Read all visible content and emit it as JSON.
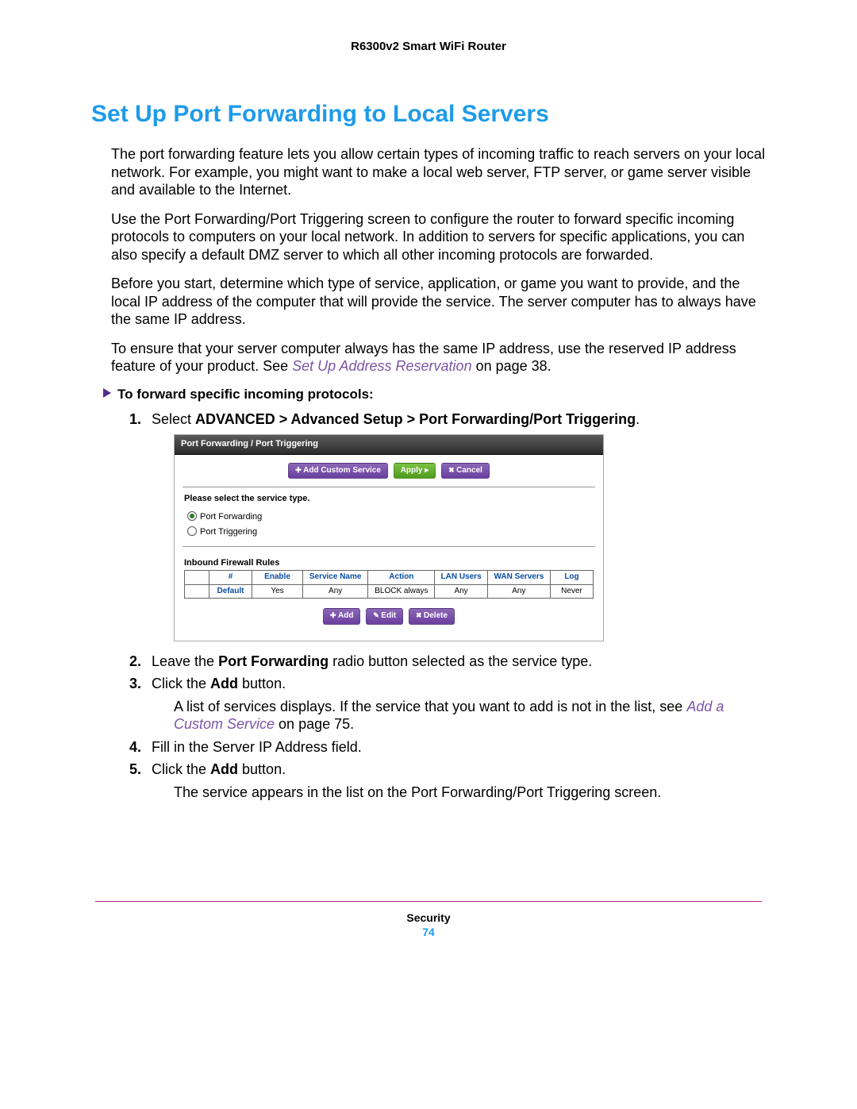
{
  "header": {
    "product": "R6300v2 Smart WiFi Router"
  },
  "title": "Set Up Port Forwarding to Local Servers",
  "paragraphs": {
    "p1": "The port forwarding feature lets you allow certain types of incoming traffic to reach servers on your local network. For example, you might want to make a local web server, FTP server, or game server visible and available to the Internet.",
    "p2": "Use the Port Forwarding/Port Triggering screen to configure the router to forward specific incoming protocols to computers on your local network. In addition to servers for specific applications, you can also specify a default DMZ server to which all other incoming protocols are forwarded.",
    "p3": "Before you start, determine which type of service, application, or game you want to provide, and the local IP address of the computer that will provide the service. The server computer has to always have the same IP address.",
    "p4a": "To ensure that your server computer always has the same IP address, use the reserved IP address feature of your product. See ",
    "p4link": "Set Up Address Reservation",
    "p4b": " on page 38."
  },
  "subheading": "To forward specific incoming protocols:",
  "steps": {
    "s1num": "1.",
    "s1a": "Select ",
    "s1b": "ADVANCED > Advanced Setup > Port Forwarding/Port Triggering",
    "s1c": ".",
    "s2num": "2.",
    "s2a": "Leave the ",
    "s2b": "Port Forwarding",
    "s2c": " radio button selected as the service type.",
    "s3num": "3.",
    "s3a": "Click the ",
    "s3b": "Add",
    "s3c": " button.",
    "s3f_a": "A list of services displays. If the service that you want to add is not in the list, see ",
    "s3f_link": "Add a Custom Service",
    "s3f_b": " on page 75.",
    "s4num": "4.",
    "s4": "Fill in the Server IP Address field.",
    "s5num": "5.",
    "s5a": "Click the ",
    "s5b": "Add",
    "s5c": " button.",
    "s5f": "The service appears in the list on the Port Forwarding/Port Triggering screen."
  },
  "panel": {
    "title": "Port Forwarding / Port Triggering",
    "buttons": {
      "add_custom": "Add Custom Service",
      "apply": "Apply",
      "cancel": "Cancel",
      "add": "Add",
      "edit": "Edit",
      "delete": "Delete"
    },
    "service_label": "Please select the service type.",
    "radios": {
      "port_forwarding": "Port Forwarding",
      "port_triggering": "Port Triggering"
    },
    "rules_label": "Inbound Firewall Rules",
    "table": {
      "headers": {
        "sel": "",
        "num": "#",
        "enable": "Enable",
        "service": "Service Name",
        "action": "Action",
        "lan": "LAN Users",
        "wan": "WAN Servers",
        "log": "Log"
      },
      "row": {
        "sel": "",
        "num": "Default",
        "enable": "Yes",
        "service": "Any",
        "action": "BLOCK always",
        "lan": "Any",
        "wan": "Any",
        "log": "Never"
      }
    }
  },
  "footer": {
    "section": "Security",
    "page": "74"
  }
}
